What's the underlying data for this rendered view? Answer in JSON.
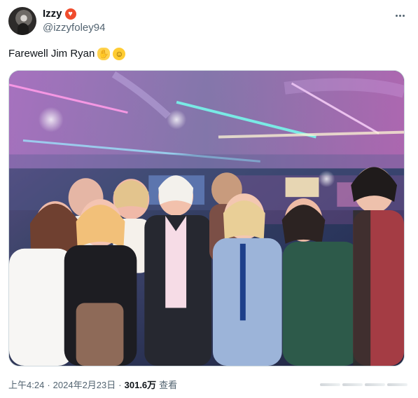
{
  "author": {
    "display_name": "Izzy",
    "name_emoji_icon": "heart-badge-icon",
    "handle": "@izzyfoley94"
  },
  "tweet": {
    "text": "Farewell Jim Ryan",
    "emojis": [
      "clapping-hands-icon",
      "saluting-face-icon"
    ]
  },
  "media": {
    "alt": "Group photo"
  },
  "meta": {
    "time": "上午4:24",
    "separator": "·",
    "date": "2024年2月23日",
    "views_count": "301.6万",
    "views_label": "查看"
  },
  "colors": {
    "text_primary": "#0f1419",
    "text_secondary": "#536471",
    "border": "#cfd9de",
    "background": "#ffffff"
  }
}
